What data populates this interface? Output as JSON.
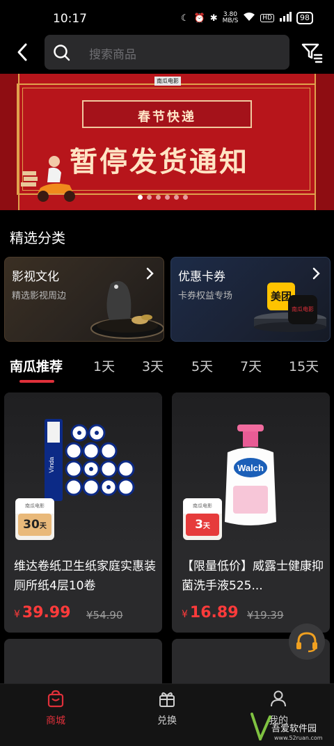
{
  "status_bar": {
    "time": "10:17",
    "net_speed": "3.80",
    "net_unit": "MB/S",
    "battery": "98"
  },
  "header": {
    "search_placeholder": "搜索商品"
  },
  "banner": {
    "logo_text": "南瓜电影",
    "subtitle": "春节快递",
    "title": "暂停发货通知",
    "dots_total": 6,
    "dots_active_index": 0
  },
  "section": {
    "title": "精选分类"
  },
  "categories": [
    {
      "name": "影视文化",
      "sub": "精选影视周边"
    },
    {
      "name": "优惠卡券",
      "sub": "卡券权益专场",
      "logo1": "美团",
      "logo2": "南瓜电影"
    }
  ],
  "tabs": [
    "南瓜推荐",
    "1天",
    "3天",
    "5天",
    "7天",
    "15天"
  ],
  "products": [
    {
      "title": "维达卷纸卫生纸家庭实惠装厕所纸4层10卷",
      "price": "39.99",
      "currency": "¥",
      "original_price": "¥54.90",
      "badge_days": "30",
      "badge_unit": "天",
      "badge_brand": "南瓜电影",
      "image_brand": "Vinda"
    },
    {
      "title": "【限量低价】威露士健康抑菌洗手液525...",
      "price": "16.89",
      "currency": "¥",
      "original_price": "¥19.39",
      "badge_days": "3",
      "badge_unit": "天",
      "badge_brand": "南瓜电影",
      "image_brand": "Walch"
    }
  ],
  "bottom_nav": [
    {
      "label": "商城",
      "icon": "shopping-bag-icon",
      "active": true
    },
    {
      "label": "兑换",
      "icon": "gift-icon",
      "active": false
    },
    {
      "label": "我的",
      "icon": "user-icon",
      "active": false
    }
  ],
  "watermark": {
    "text": "吾爱软件园",
    "url": "www.52ruan.com"
  },
  "colors": {
    "accent": "#e0303a",
    "price": "#ff3b3b",
    "banner_red": "#b7151b"
  }
}
